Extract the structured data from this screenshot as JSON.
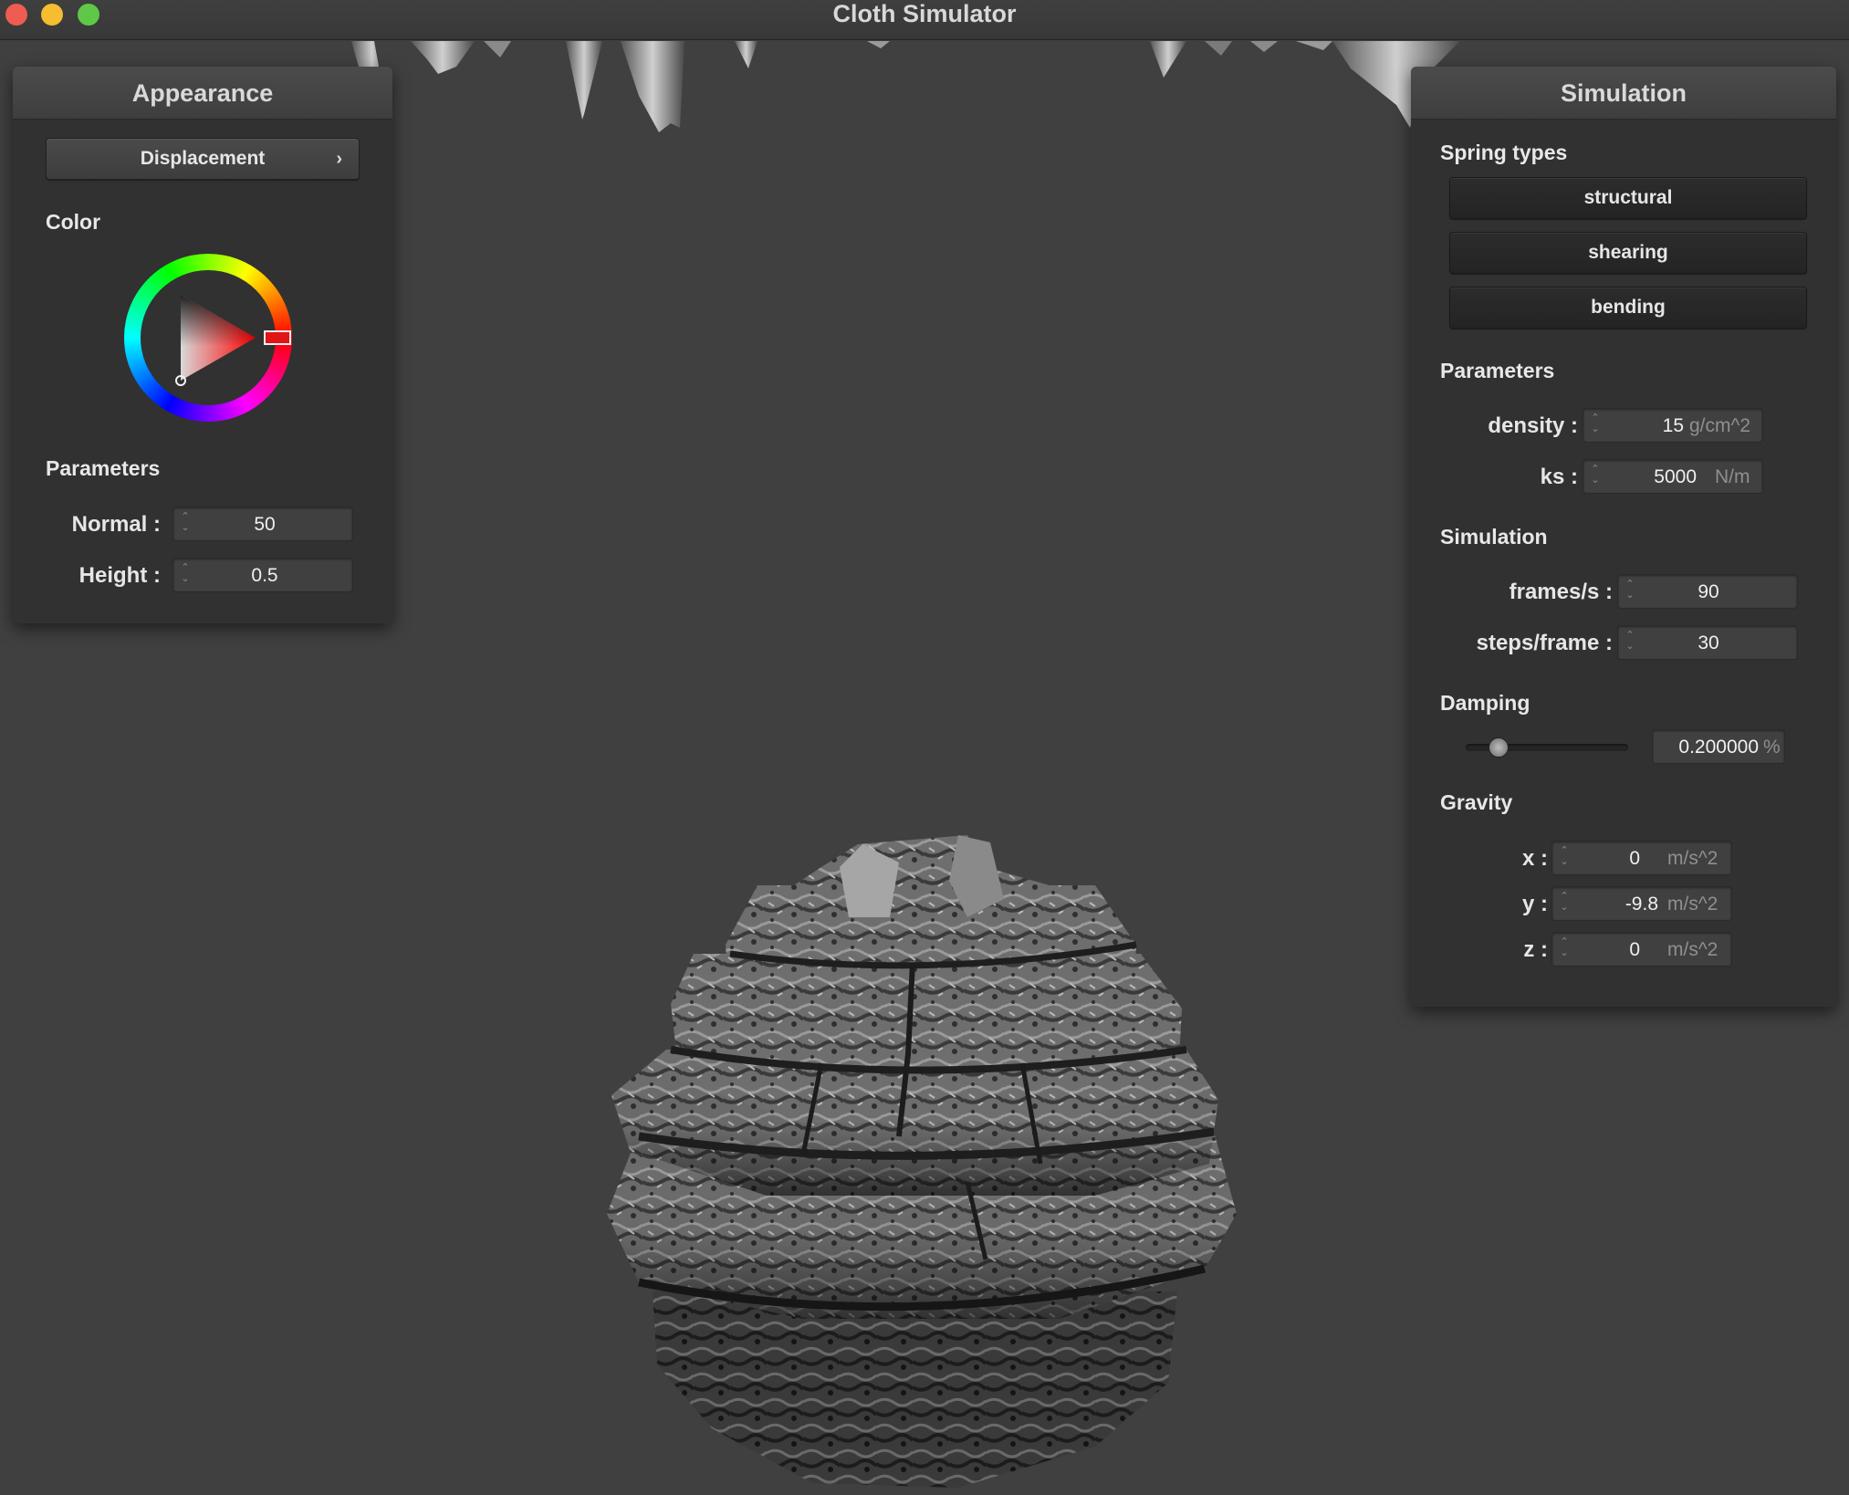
{
  "window": {
    "title": "Cloth Simulator"
  },
  "appearance": {
    "title": "Appearance",
    "shader_button": "Displacement",
    "color_label": "Color",
    "selected_color": "#e01515",
    "parameters_label": "Parameters",
    "normal": {
      "label": "Normal :",
      "value": "50"
    },
    "height": {
      "label": "Height :",
      "value": "0.5"
    }
  },
  "simulation": {
    "title": "Simulation",
    "spring_types_label": "Spring types",
    "springs": [
      "structural",
      "shearing",
      "bending"
    ],
    "parameters_label": "Parameters",
    "density": {
      "label": "density :",
      "value": "15",
      "unit": "g/cm^2"
    },
    "ks": {
      "label": "ks :",
      "value": "5000",
      "unit": "N/m"
    },
    "simulation_label": "Simulation",
    "fps": {
      "label": "frames/s :",
      "value": "90"
    },
    "steps": {
      "label": "steps/frame :",
      "value": "30"
    },
    "damping_label": "Damping",
    "damping": {
      "value": "0.200000",
      "unit": "%",
      "level": 0.2
    },
    "gravity_label": "Gravity",
    "gx": {
      "label": "x :",
      "value": "0",
      "unit": "m/s^2"
    },
    "gy": {
      "label": "y :",
      "value": "-9.8",
      "unit": "m/s^2"
    },
    "gz": {
      "label": "z :",
      "value": "0",
      "unit": "m/s^2"
    }
  }
}
